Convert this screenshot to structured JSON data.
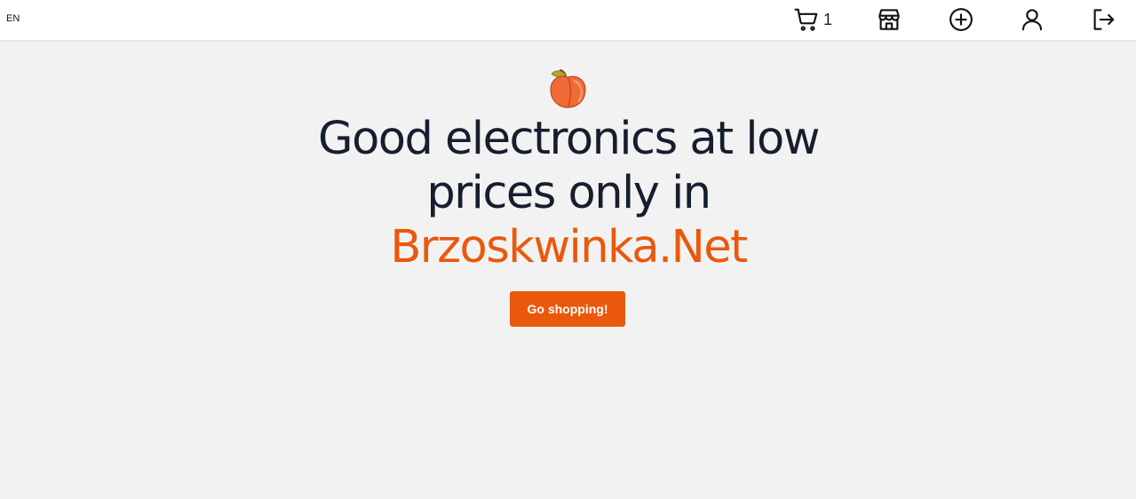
{
  "header": {
    "language": "EN",
    "cart_count": "1",
    "icons": [
      "cart-icon",
      "store-icon",
      "add-circle-icon",
      "user-icon",
      "logout-icon"
    ]
  },
  "hero": {
    "headline_line1": "Good electronics at low",
    "headline_line2": "prices only in",
    "brand_name": "Brzoskwinka.Net",
    "cta_label": "Go shopping!",
    "logo": "peach-icon"
  },
  "colors": {
    "accent": "#ea580c",
    "headline": "#161e2e",
    "background": "#f2f2f2",
    "header_bg": "#ffffff"
  }
}
